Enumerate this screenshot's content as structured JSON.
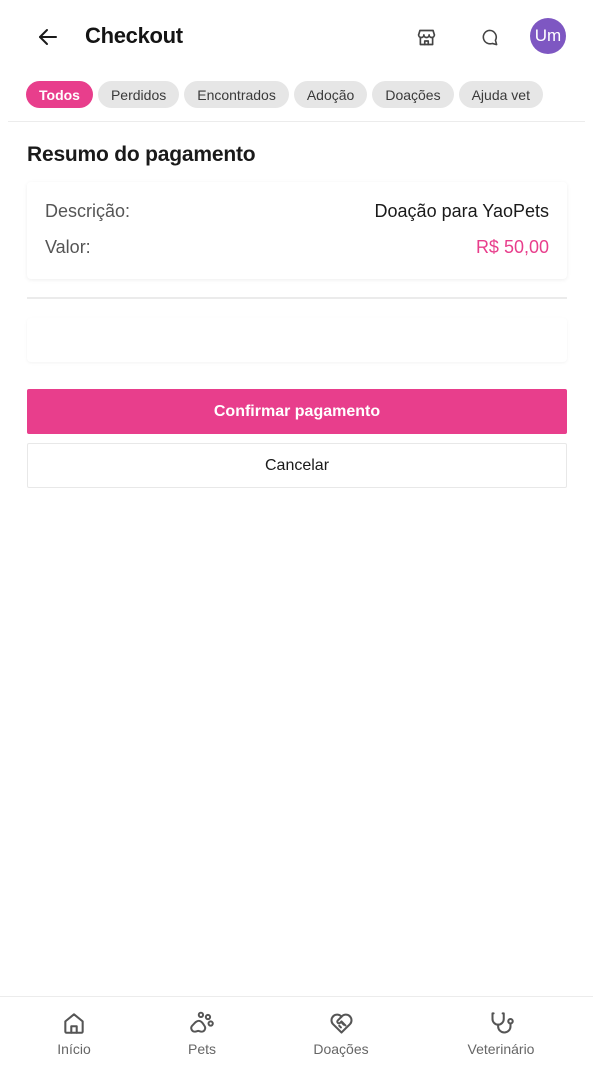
{
  "header": {
    "title": "Checkout",
    "avatar_initials": "Um",
    "icons": {
      "back": "arrow-left-icon",
      "store": "store-icon",
      "chat": "chat-bubble-icon"
    }
  },
  "chips": [
    {
      "label": "Todos",
      "active": true
    },
    {
      "label": "Perdidos",
      "active": false
    },
    {
      "label": "Encontrados",
      "active": false
    },
    {
      "label": "Adoção",
      "active": false
    },
    {
      "label": "Doações",
      "active": false
    },
    {
      "label": "Ajuda vet",
      "active": false
    }
  ],
  "summary": {
    "title": "Resumo do pagamento",
    "description_label": "Descrição:",
    "description_value": "Doação para YaoPets",
    "amount_label": "Valor:",
    "amount_value": "R$ 50,00"
  },
  "actions": {
    "confirm_label": "Confirmar pagamento",
    "cancel_label": "Cancelar"
  },
  "bottom_nav": [
    {
      "label": "Início",
      "icon": "home-icon"
    },
    {
      "label": "Pets",
      "icon": "paw-icon"
    },
    {
      "label": "Doações",
      "icon": "heart-handshake-icon"
    },
    {
      "label": "Veterinário",
      "icon": "stethoscope-icon"
    }
  ],
  "colors": {
    "accent": "#e83e8c",
    "avatar": "#7e57c2",
    "chip_bg": "#e6e6e6",
    "nav_icon": "#555555"
  }
}
